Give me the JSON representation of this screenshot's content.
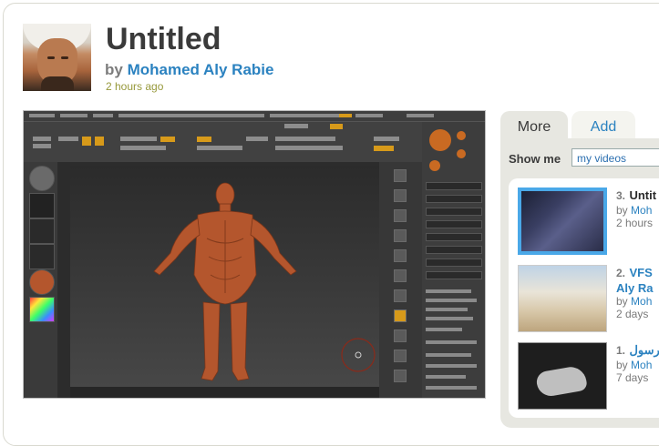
{
  "page": {
    "title": "Untitled",
    "by_prefix": "by",
    "author": "Mohamed Aly Rabie",
    "time": "2 hours ago"
  },
  "sidebar": {
    "tabs": [
      {
        "label": "More",
        "active": true
      },
      {
        "label": "Add",
        "active": false
      }
    ],
    "show_me_label": "Show me",
    "show_me_value": "my videos",
    "videos": [
      {
        "num": "3.",
        "title": "Untit",
        "by": "by",
        "author": "Moh",
        "time": "2 hours"
      },
      {
        "num": "2.",
        "title": "VFS",
        "title2": "Aly Ra",
        "by": "by",
        "author": "Moh",
        "time": "2 days"
      },
      {
        "num": "1.",
        "title": "رسول",
        "by": "by",
        "author": "Moh",
        "time": "7 days"
      }
    ]
  },
  "colors": {
    "link": "#2b82c0",
    "time": "#97993b",
    "panel": "#e7e7e1",
    "model": "#b4562d"
  }
}
